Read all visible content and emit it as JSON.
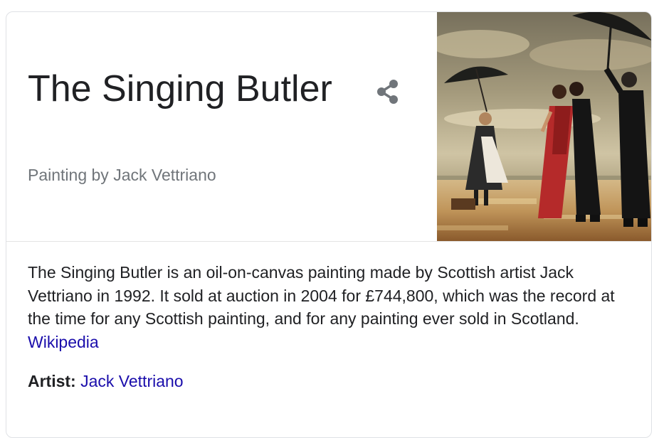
{
  "panel": {
    "title": "The Singing Butler",
    "subtitle": "Painting by Jack Vettriano",
    "share_icon": "share-icon",
    "image_subject": "painting-thumbnail"
  },
  "description": {
    "text": "The Singing Butler is an oil-on-canvas painting made by Scottish artist Jack Vettriano in 1992. It sold at auction in 2004 for £744,800, which was the record at the time for any Scottish painting, and for any painting ever sold in Scotland.",
    "source_link": "Wikipedia"
  },
  "facts": [
    {
      "label": "Artist:",
      "value": "Jack Vettriano"
    }
  ],
  "colors": {
    "link": "#1a0dab",
    "subtitle": "#70757a",
    "text": "#202124",
    "border": "#dfe1e5"
  }
}
